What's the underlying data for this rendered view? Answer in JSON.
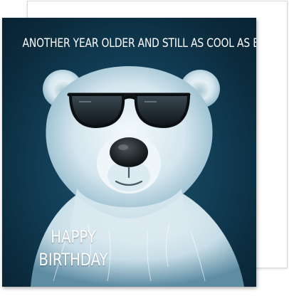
{
  "card": {
    "top_caption": "ANOTHER YEAR OLDER AND STILL AS COOL AS EVER",
    "greeting_line1": "HAPPY",
    "greeting_line2": "BIRTHDAY"
  },
  "colors": {
    "background_dark": "#0b2a3c",
    "background_mid": "#1f5470",
    "fur": "#e8f2f6",
    "text": "#ffffff"
  }
}
